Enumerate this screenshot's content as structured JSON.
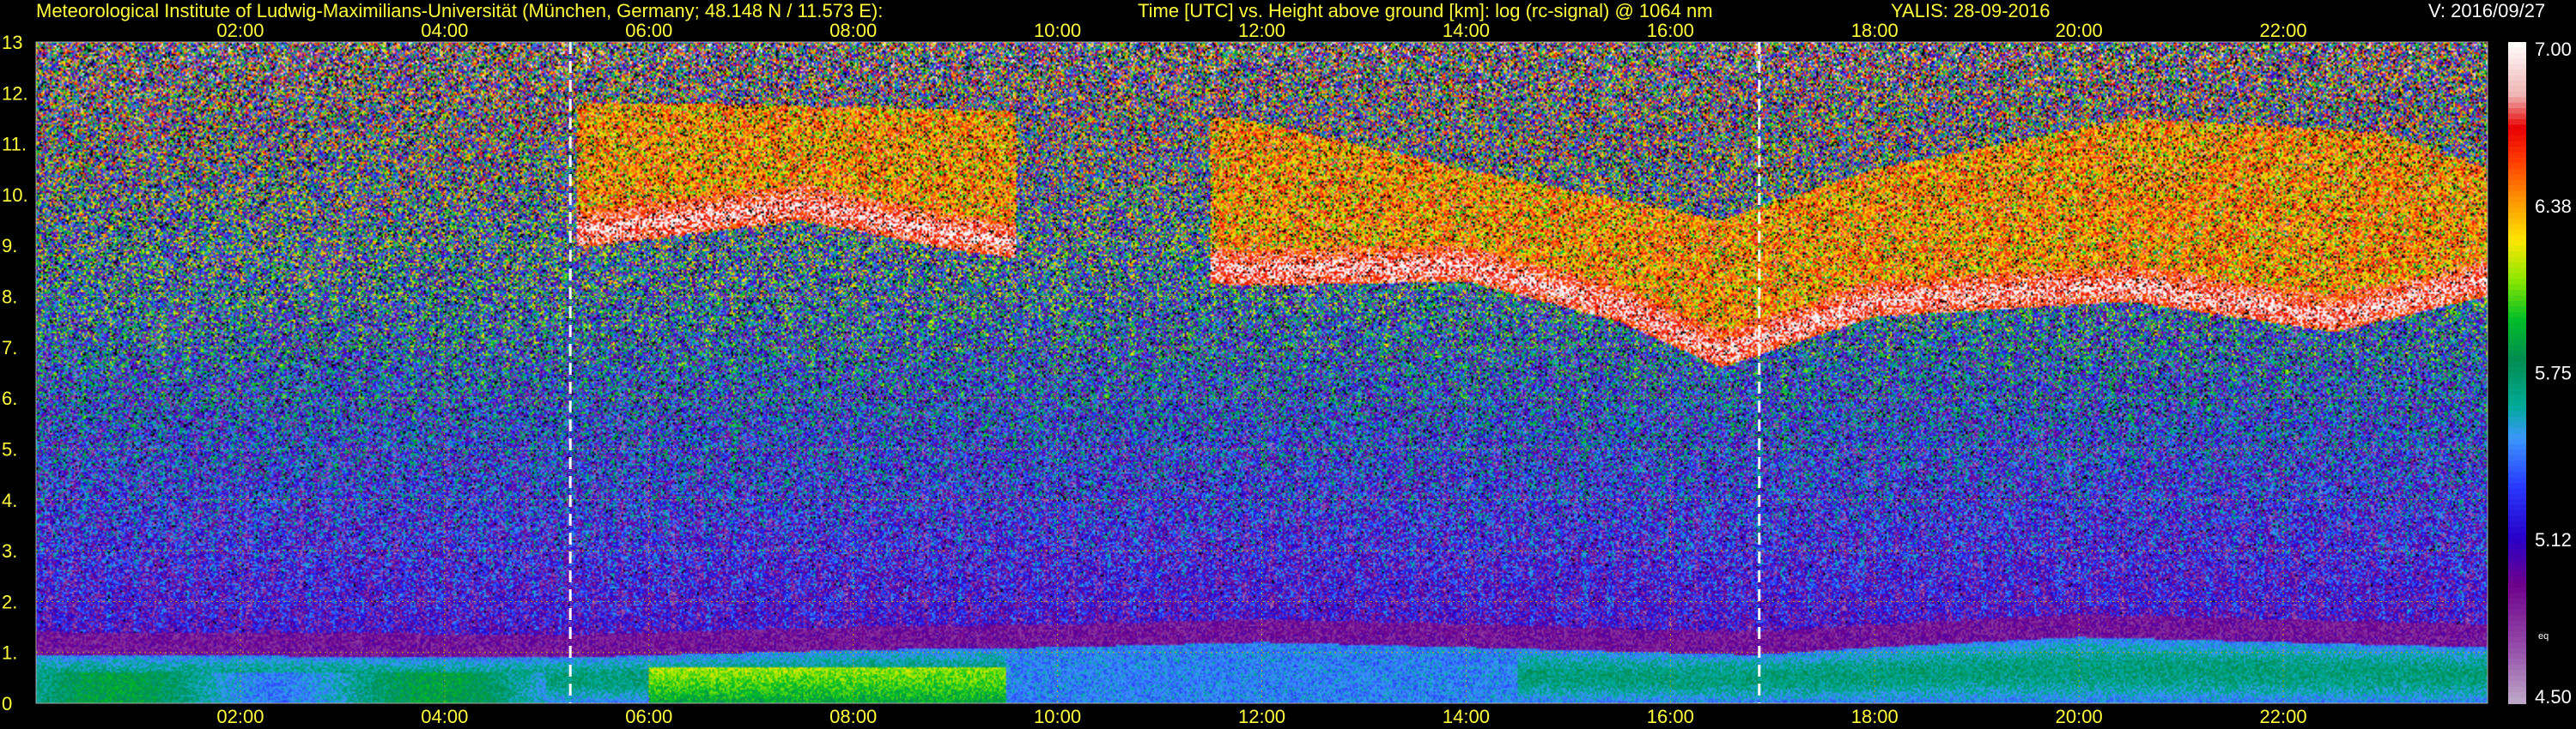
{
  "header": {
    "institute": "Meteorological Institute of Ludwig-Maximilians-Universität (München, Germany; 48.148 N / 11.573 E):",
    "description": "Time [UTC] vs. Height above ground [km]: log (rc-signal) @ 1064 nm",
    "instrument": "YALIS: 28-09-2016",
    "version": "V: 2016/09/27"
  },
  "chart_data": {
    "type": "heatmap",
    "variable": "log (rc-signal) @ 1064 nm",
    "xlim": [
      0,
      24
    ],
    "ylim": [
      0,
      13
    ],
    "x_ticks": [
      "02:00",
      "04:00",
      "06:00",
      "08:00",
      "10:00",
      "12:00",
      "14:00",
      "16:00",
      "18:00",
      "20:00",
      "22:00"
    ],
    "y_ticks": [
      "0",
      "1.",
      "2.",
      "3.",
      "4.",
      "5.",
      "6.",
      "7.",
      "8.",
      "9.",
      "10.",
      "11.",
      "12.",
      "13"
    ],
    "grid": true,
    "markers_hours": [
      5.23,
      16.87
    ],
    "colorbar": {
      "range": [
        4.5,
        7.0
      ],
      "tick_labels": [
        "7.00",
        "6.38",
        "5.75",
        "5.12",
        "4.50"
      ],
      "extra_label": "eq"
    },
    "boundary_layer_top_km": [
      [
        0,
        0.95
      ],
      [
        5.2,
        0.9
      ],
      [
        8,
        1.05
      ],
      [
        10,
        1.1
      ],
      [
        12,
        1.2
      ],
      [
        14,
        1.1
      ],
      [
        16.8,
        0.95
      ],
      [
        18,
        1.1
      ],
      [
        20,
        1.3
      ],
      [
        22,
        1.2
      ],
      [
        24,
        1.1
      ]
    ],
    "cloud_base_km": [
      [
        5.5,
        9.3
      ],
      [
        7.5,
        9.8
      ],
      [
        9,
        9.2
      ],
      [
        11.8,
        8.5
      ],
      [
        14,
        8.6
      ],
      [
        15.5,
        7.8
      ],
      [
        16.5,
        6.9
      ],
      [
        18,
        7.9
      ],
      [
        20.5,
        8.2
      ],
      [
        22.5,
        7.6
      ],
      [
        24,
        8.3
      ]
    ],
    "cloud_top_km": [
      [
        6,
        11.8
      ],
      [
        8.5,
        11.7
      ],
      [
        11.8,
        11.5
      ],
      [
        14,
        10.5
      ],
      [
        16.5,
        9.5
      ],
      [
        18,
        10.5
      ],
      [
        20.5,
        11.5
      ],
      [
        23,
        11.2
      ],
      [
        24,
        10.5
      ]
    ]
  }
}
